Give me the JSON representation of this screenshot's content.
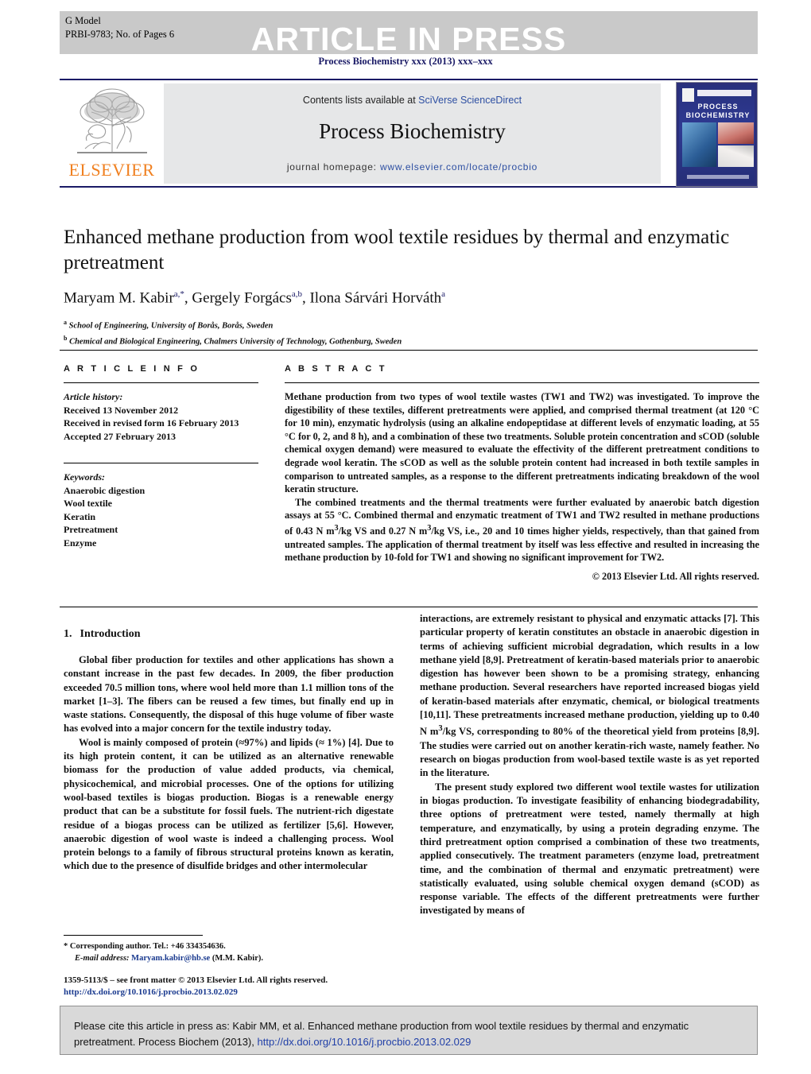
{
  "banner": {
    "g_model": "G Model",
    "article_id": "PRBI-9783;   No. of Pages 6",
    "status": "ARTICLE IN PRESS",
    "journal_ref": "Process Biochemistry xxx (2013) xxx–xxx"
  },
  "masthead": {
    "publisher_name": "ELSEVIER",
    "contents_prefix": "Contents lists available at ",
    "contents_link": "SciVerse ScienceDirect",
    "journal_title": "Process Biochemistry",
    "homepage_prefix": "journal homepage: ",
    "homepage_url": "www.elsevier.com/locate/procbio",
    "cover_title": "PROCESS BIOCHEMISTRY"
  },
  "article": {
    "title": "Enhanced methane production from wool textile residues by thermal and enzymatic pretreatment",
    "authors": [
      {
        "name": "Maryam M. Kabir",
        "marks": "a,*"
      },
      {
        "name": "Gergely Forgács",
        "marks": "a,b"
      },
      {
        "name": "Ilona Sárvári Horváth",
        "marks": "a"
      }
    ],
    "affiliations": [
      {
        "mark": "a",
        "text": "School of Engineering, University of Borås, Borås, Sweden"
      },
      {
        "mark": "b",
        "text": "Chemical and Biological Engineering, Chalmers University of Technology, Gothenburg, Sweden"
      }
    ]
  },
  "article_info": {
    "heading": "A R T I C L E   I N F O",
    "history_label": "Article history:",
    "history": [
      "Received 13 November 2012",
      "Received in revised form 16 February 2013",
      "Accepted 27 February 2013"
    ],
    "keywords_label": "Keywords:",
    "keywords": [
      "Anaerobic digestion",
      "Wool textile",
      "Keratin",
      "Pretreatment",
      "Enzyme"
    ]
  },
  "abstract": {
    "heading": "A B S T R A C T",
    "paragraph_1": "Methane production from two types of wool textile wastes (TW1 and TW2) was investigated. To improve the digestibility of these textiles, different pretreatments were applied, and comprised thermal treatment (at 120 °C for 10 min), enzymatic hydrolysis (using an alkaline endopeptidase at different levels of enzymatic loading, at 55 °C for 0, 2, and 8 h), and a combination of these two treatments. Soluble protein concentration and sCOD (soluble chemical oxygen demand) were measured to evaluate the effectivity of the different pretreatment conditions to degrade wool keratin. The sCOD as well as the soluble protein content had increased in both textile samples in comparison to untreated samples, as a response to the different pretreatments indicating breakdown of the wool keratin structure.",
    "paragraph_2": "The combined treatments and the thermal treatments were further evaluated by anaerobic batch digestion assays at 55 °C. Combined thermal and enzymatic treatment of TW1 and TW2 resulted in methane productions of 0.43 N m3/kg VS and 0.27 N m3/kg VS, i.e., 20 and 10 times higher yields, respectively, than that gained from untreated samples. The application of thermal treatment by itself was less effective and resulted in increasing the methane production by 10-fold for TW1 and showing no significant improvement for TW2.",
    "copyright": "© 2013 Elsevier Ltd. All rights reserved."
  },
  "introduction": {
    "number": "1.",
    "heading": "Introduction",
    "left_p1": "Global fiber production for textiles and other applications has shown a constant increase in the past few decades. In 2009, the fiber production exceeded 70.5 million tons, where wool held more than 1.1 million tons of the market [1–3]. The fibers can be reused a few times, but finally end up in waste stations. Consequently, the disposal of this huge volume of fiber waste has evolved into a major concern for the textile industry today.",
    "left_p2": "Wool is mainly composed of protein (≈97%) and lipids (≈ 1%) [4]. Due to its high protein content, it can be utilized as an alternative renewable biomass for the production of value added products, via chemical, physicochemical, and microbial processes. One of the options for utilizing wool-based textiles is biogas production. Biogas is a renewable energy product that can be a substitute for fossil fuels. The nutrient-rich digestate residue of a biogas process can be utilized as fertilizer [5,6]. However, anaerobic digestion of wool waste is indeed a challenging process. Wool protein belongs to a family of fibrous structural proteins known as keratin, which due to the presence of disulfide bridges and other intermolecular",
    "right_p1": "interactions, are extremely resistant to physical and enzymatic attacks [7]. This particular property of keratin constitutes an obstacle in anaerobic digestion in terms of achieving sufficient microbial degradation, which results in a low methane yield [8,9]. Pretreatment of keratin-based materials prior to anaerobic digestion has however been shown to be a promising strategy, enhancing methane production. Several researchers have reported increased biogas yield of keratin-based materials after enzymatic, chemical, or biological treatments [10,11]. These pretreatments increased methane production, yielding up to 0.40 N m3/kg VS, corresponding to 80% of the theoretical yield from proteins [8,9]. The studies were carried out on another keratin-rich waste, namely feather. No research on biogas production from wool-based textile waste is as yet reported in the literature.",
    "right_p2": "The present study explored two different wool textile wastes for utilization in biogas production. To investigate feasibility of enhancing biodegradability, three options of pretreatment were tested, namely thermally at high temperature, and enzymatically, by using a protein degrading enzyme. The third pretreatment option comprised a combination of these two treatments, applied consecutively. The treatment parameters (enzyme load, pretreatment time, and the combination of thermal and enzymatic pretreatment) were statistically evaluated, using soluble chemical oxygen demand (sCOD) as response variable. The effects of the different pretreatments were further investigated by means of"
  },
  "footnote": {
    "corresponding": "* Corresponding author. Tel.: +46 334354636.",
    "email_label": "E-mail address:",
    "email": "Maryam.kabir@hb.se",
    "email_suffix": "(M.M. Kabir).",
    "imprint": "1359-5113/$ – see front matter © 2013 Elsevier Ltd. All rights reserved.",
    "doi": "http://dx.doi.org/10.1016/j.procbio.2013.02.029"
  },
  "cite_box": {
    "text": "Please cite this article in press as: Kabir MM, et al. Enhanced methane production from wool textile residues by thermal and enzymatic pretreatment. Process Biochem (2013), ",
    "doi": "http://dx.doi.org/10.1016/j.procbio.2013.02.029"
  },
  "colors": {
    "banner_gray": "#c9c9c9",
    "journal_navy": "#1a1a66",
    "link_blue": "#2d4fa2",
    "elsevier_orange": "#f08020",
    "cite_box_gray": "#d9d9d9"
  }
}
